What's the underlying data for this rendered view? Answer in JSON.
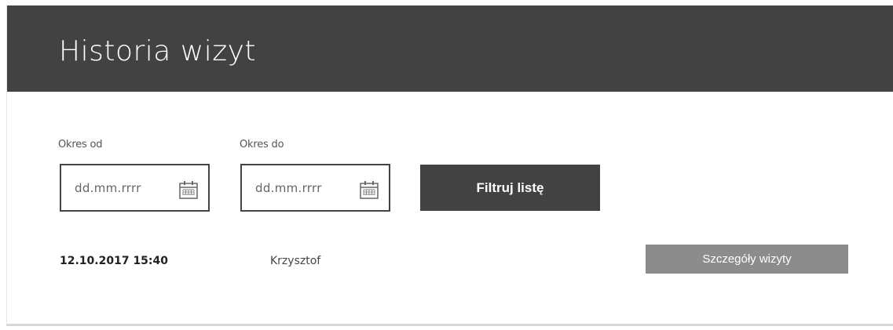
{
  "header": {
    "title": "Historia wizyt",
    "background_color": "#424242"
  },
  "filters": {
    "from": {
      "label": "Okres od",
      "placeholder": "dd.mm.rrrr",
      "icon": "calendar-icon"
    },
    "to": {
      "label": "Okres do",
      "placeholder": "dd.mm.rrrr",
      "icon": "calendar-icon"
    },
    "filter_button_label": "Filtruj listę"
  },
  "visits": [
    {
      "datetime": "12.10.2017 15:40",
      "name": "Krzysztof",
      "details_button_label": "Szczegóły wizyty"
    }
  ],
  "colors": {
    "primary_button": "#424242",
    "secondary_button": "#8c8c8c"
  }
}
